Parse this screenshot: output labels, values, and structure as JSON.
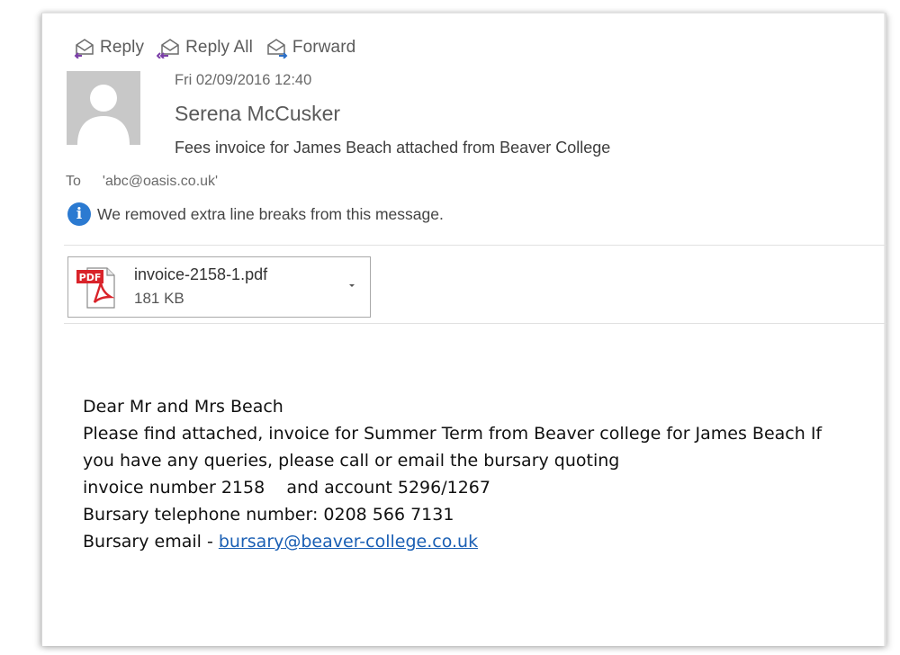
{
  "toolbar": {
    "reply_label": "Reply",
    "reply_all_label": "Reply All",
    "forward_label": "Forward"
  },
  "message": {
    "date": "Fri 02/09/2016 12:40",
    "sender": "Serena McCusker",
    "subject": "Fees invoice for James Beach attached from Beaver College",
    "to_label": "To",
    "to_value": "'abc@oasis.co.uk'",
    "info_notice": "We removed extra line breaks from this message."
  },
  "attachment": {
    "name": "invoice-2158-1.pdf",
    "size": "181 KB",
    "badge": "PDF"
  },
  "body": {
    "greeting": "Dear Mr and Mrs Beach",
    "line1": "Please find attached, invoice for Summer Term from Beaver college for James Beach If",
    "line2": "you have any queries, please call or email the bursary quoting",
    "line3": "invoice number 2158    and account 5296/1267",
    "line4": "Bursary telephone number: 0208 566 7131",
    "email_prefix": "Bursary email - ",
    "email_link": "bursary@beaver-college.co.uk"
  },
  "colors": {
    "accent_blue": "#2b7ad1",
    "link_blue": "#1a5fb4",
    "pdf_red": "#d9232a"
  },
  "icons": {
    "reply": "reply-envelope-icon",
    "reply_all": "reply-all-envelope-icon",
    "forward": "forward-envelope-icon",
    "info": "info-icon",
    "attachment": "pdf-file-icon",
    "dropdown": "chevron-down-icon",
    "avatar": "person-silhouette-icon"
  }
}
